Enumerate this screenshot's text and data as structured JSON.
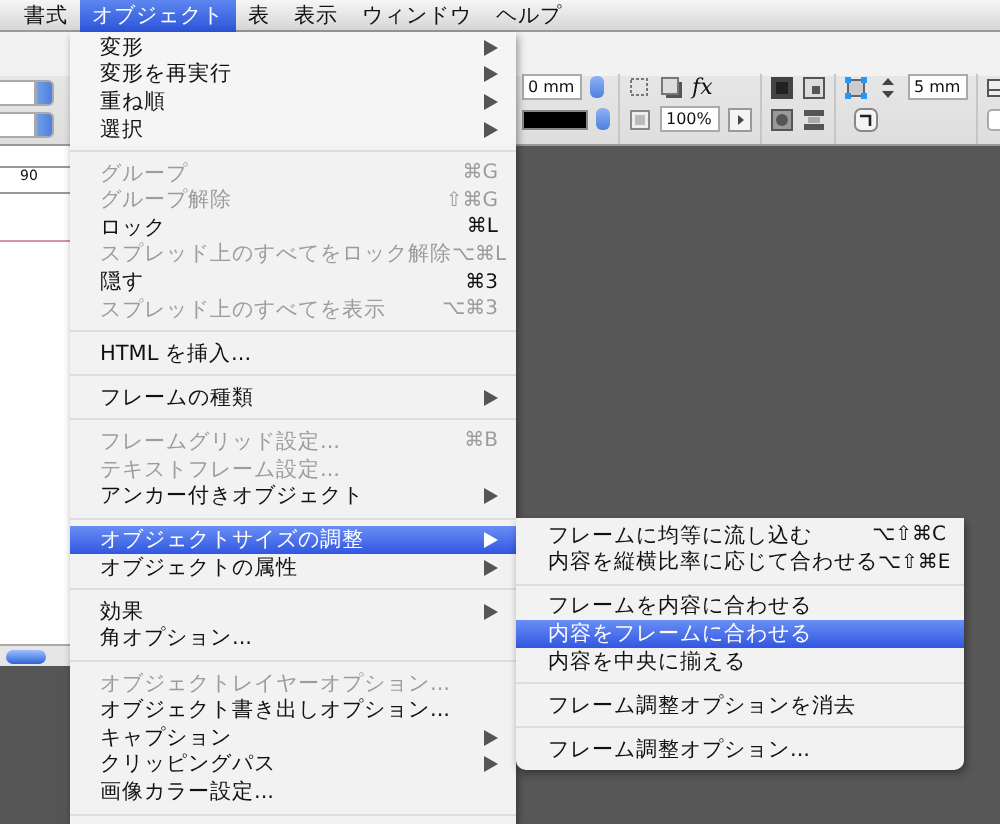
{
  "menubar": [
    {
      "label": "書式",
      "selected": false
    },
    {
      "label": "オブジェクト",
      "selected": true
    },
    {
      "label": "表",
      "selected": false
    },
    {
      "label": "表示",
      "selected": false
    },
    {
      "label": "ウィンドウ",
      "selected": false
    },
    {
      "label": "ヘルプ",
      "selected": false
    }
  ],
  "toolbar": {
    "offset_field": "0 mm",
    "scale_field": "100%",
    "effects_label": "fx",
    "corner_size_field": "5 mm"
  },
  "ruler": {
    "label": "90"
  },
  "menu": {
    "items": [
      {
        "kind": "item",
        "label": "変形",
        "submenu": true,
        "disabled": false,
        "selected": false
      },
      {
        "kind": "item",
        "label": "変形を再実行",
        "submenu": true,
        "disabled": false,
        "selected": false
      },
      {
        "kind": "item",
        "label": "重ね順",
        "submenu": true,
        "disabled": false,
        "selected": false
      },
      {
        "kind": "item",
        "label": "選択",
        "submenu": true,
        "disabled": false,
        "selected": false
      },
      {
        "kind": "separator"
      },
      {
        "kind": "item",
        "label": "グループ",
        "shortcut": "⌘G",
        "disabled": true,
        "selected": false
      },
      {
        "kind": "item",
        "label": "グループ解除",
        "shortcut": "⇧⌘G",
        "disabled": true,
        "selected": false
      },
      {
        "kind": "item",
        "label": "ロック",
        "shortcut": "⌘L",
        "disabled": false,
        "selected": false
      },
      {
        "kind": "item",
        "label": "スプレッド上のすべてをロック解除",
        "shortcut": "⌥⌘L",
        "disabled": true,
        "selected": false
      },
      {
        "kind": "item",
        "label": "隠す",
        "shortcut": "⌘3",
        "disabled": false,
        "selected": false
      },
      {
        "kind": "item",
        "label": "スプレッド上のすべてを表示",
        "shortcut": "⌥⌘3",
        "disabled": true,
        "selected": false
      },
      {
        "kind": "separator"
      },
      {
        "kind": "item",
        "label": "HTML を挿入...",
        "disabled": false,
        "selected": false
      },
      {
        "kind": "separator"
      },
      {
        "kind": "item",
        "label": "フレームの種類",
        "submenu": true,
        "disabled": false,
        "selected": false
      },
      {
        "kind": "separator"
      },
      {
        "kind": "item",
        "label": "フレームグリッド設定...",
        "shortcut": "⌘B",
        "disabled": true,
        "selected": false
      },
      {
        "kind": "item",
        "label": "テキストフレーム設定...",
        "disabled": true,
        "selected": false
      },
      {
        "kind": "item",
        "label": "アンカー付きオブジェクト",
        "submenu": true,
        "disabled": false,
        "selected": false
      },
      {
        "kind": "separator"
      },
      {
        "kind": "item",
        "label": "オブジェクトサイズの調整",
        "submenu": true,
        "disabled": false,
        "selected": true
      },
      {
        "kind": "item",
        "label": "オブジェクトの属性",
        "submenu": true,
        "disabled": false,
        "selected": false
      },
      {
        "kind": "separator"
      },
      {
        "kind": "item",
        "label": "効果",
        "submenu": true,
        "disabled": false,
        "selected": false
      },
      {
        "kind": "item",
        "label": "角オプション...",
        "disabled": false,
        "selected": false
      },
      {
        "kind": "separator"
      },
      {
        "kind": "item",
        "label": "オブジェクトレイヤーオプション...",
        "disabled": true,
        "selected": false
      },
      {
        "kind": "item",
        "label": "オブジェクト書き出しオプション...",
        "disabled": false,
        "selected": false
      },
      {
        "kind": "item",
        "label": "キャプション",
        "submenu": true,
        "disabled": false,
        "selected": false
      },
      {
        "kind": "item",
        "label": "クリッピングパス",
        "submenu": true,
        "disabled": false,
        "selected": false
      },
      {
        "kind": "item",
        "label": "画像カラー設定...",
        "disabled": false,
        "selected": false
      },
      {
        "kind": "separator"
      }
    ]
  },
  "submenu": {
    "items": [
      {
        "kind": "item",
        "label": "フレームに均等に流し込む",
        "shortcut": "⌥⇧⌘C",
        "disabled": false,
        "selected": false
      },
      {
        "kind": "item",
        "label": "内容を縦横比率に応じて合わせる",
        "shortcut": "⌥⇧⌘E",
        "disabled": false,
        "selected": false
      },
      {
        "kind": "separator"
      },
      {
        "kind": "item",
        "label": "フレームを内容に合わせる",
        "disabled": false,
        "selected": false
      },
      {
        "kind": "item",
        "label": "内容をフレームに合わせる",
        "disabled": false,
        "selected": true
      },
      {
        "kind": "item",
        "label": "内容を中央に揃える",
        "disabled": false,
        "selected": false
      },
      {
        "kind": "separator"
      },
      {
        "kind": "item",
        "label": "フレーム調整オプションを消去",
        "disabled": false,
        "selected": false
      },
      {
        "kind": "separator"
      },
      {
        "kind": "item",
        "label": "フレーム調整オプション...",
        "disabled": false,
        "selected": false
      }
    ]
  }
}
